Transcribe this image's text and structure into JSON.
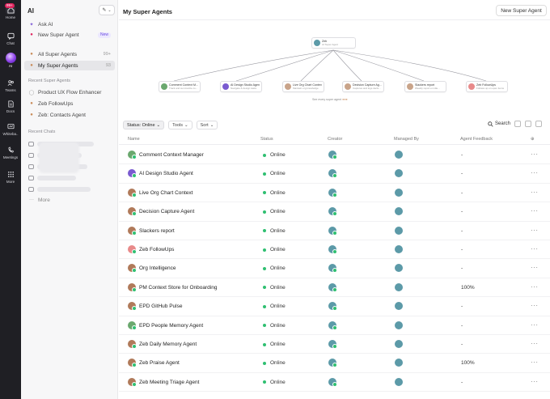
{
  "rail": {
    "badge": "99+",
    "items": [
      {
        "label": "Home",
        "icon": "home-icon"
      },
      {
        "label": "Chat",
        "icon": "chat-icon"
      },
      {
        "label": "AI",
        "icon": "ai-orb-icon"
      },
      {
        "label": "Teams",
        "icon": "teams-icon"
      },
      {
        "label": "Docs",
        "icon": "docs-icon"
      },
      {
        "label": "Whiteba..",
        "icon": "whiteboard-icon"
      },
      {
        "label": "Meetings",
        "icon": "meetings-icon"
      },
      {
        "label": "More",
        "icon": "grid-icon"
      }
    ]
  },
  "sidebar": {
    "title": "AI",
    "ask_ai": "Ask AI",
    "new_super_agent": "New Super Agent",
    "new_badge": "New",
    "all_super_agents": "All Super Agents",
    "all_count": "99+",
    "my_super_agents": "My Super Agents",
    "my_count": "93",
    "recent_agents_heading": "Recent Super Agents",
    "recent_agents": [
      "Product UX Flow Enhancer",
      "Zeb FollowUps",
      "Zeb: Contacts Agent"
    ],
    "recent_chats_heading": "Recent Chats",
    "more": "More"
  },
  "main": {
    "title": "My Super Agents",
    "new_button": "New Super Agent",
    "org_chart": {
      "root": {
        "name": "Zeb",
        "sub": "AI Super Agent"
      },
      "children": [
        {
          "name": "Comment Context M...",
          "sub": "Track and summarize co..."
        },
        {
          "name": "AI Design Studio Agent",
          "sub": "Navigate & design tasks"
        },
        {
          "name": "Live Org Chart Context",
          "sub": "Maintain org knowledge"
        },
        {
          "name": "Decision Capture Ag...",
          "sub": "Captures and logs decis..."
        },
        {
          "name": "Slackers report",
          "sub": "Weekly report on idle..."
        },
        {
          "name": "Zeb FollowUps",
          "sub": "Follows up on open items"
        }
      ],
      "caption": "See every super agent"
    },
    "toolbar": {
      "status": "Status: Online",
      "tools": "Tools",
      "sort": "Sort",
      "search": "Search"
    },
    "columns": {
      "name": "Name",
      "status": "Status",
      "creator": "Creator",
      "managed_by": "Managed By",
      "feedback": "Agent Feedback"
    },
    "rows": [
      {
        "name": "Comment Context Manager",
        "status": "Online",
        "feedback": "-"
      },
      {
        "name": "AI Design Studio Agent",
        "status": "Online",
        "feedback": "-"
      },
      {
        "name": "Live Org Chart Context",
        "status": "Online",
        "feedback": "-"
      },
      {
        "name": "Decision Capture Agent",
        "status": "Online",
        "feedback": "-"
      },
      {
        "name": "Slackers report",
        "status": "Online",
        "feedback": "-"
      },
      {
        "name": "Zeb FollowUps",
        "status": "Online",
        "feedback": "-"
      },
      {
        "name": "Org Intelligence",
        "status": "Online",
        "feedback": "-"
      },
      {
        "name": "PM Context Store for Onboarding",
        "status": "Online",
        "feedback": "100%"
      },
      {
        "name": "EPD GitHub Pulse",
        "status": "Online",
        "feedback": "-"
      },
      {
        "name": "EPD People Memory Agent",
        "status": "Online",
        "feedback": "-"
      },
      {
        "name": "Zeb Daily Memory Agent",
        "status": "Online",
        "feedback": "-"
      },
      {
        "name": "Zeb Praise Agent",
        "status": "Online",
        "feedback": "100%"
      },
      {
        "name": "Zeb Meeting Triage Agent",
        "status": "Online",
        "feedback": "-"
      }
    ]
  }
}
